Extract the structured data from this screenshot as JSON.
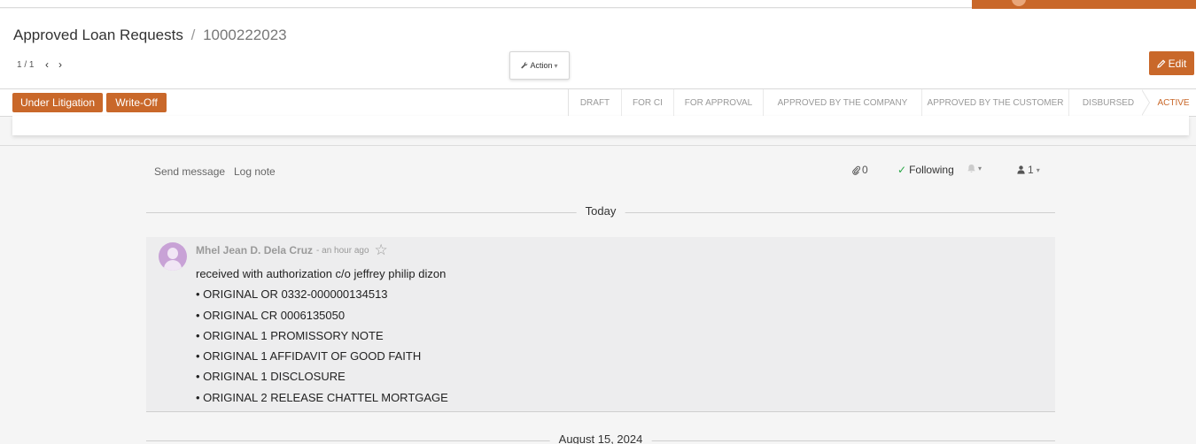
{
  "breadcrumb": {
    "parent": "Approved Loan Requests",
    "separator": "/",
    "record": "1000222023"
  },
  "pager": {
    "value": "1 / 1"
  },
  "buttons": {
    "action": "Action",
    "edit": "Edit",
    "under_litigation": "Under Litigation",
    "write_off": "Write-Off"
  },
  "stages": [
    "DRAFT",
    "FOR CI",
    "FOR APPROVAL",
    "APPROVED BY THE COMPANY",
    "APPROVED BY THE CUSTOMER",
    "DISBURSED",
    "ACTIVE"
  ],
  "active_stage": "ACTIVE",
  "chatter": {
    "send_message": "Send message",
    "log_note": "Log note",
    "attachments": "0",
    "following": "Following",
    "followers": "1"
  },
  "date_separators": {
    "today": "Today",
    "previous": "August 15, 2024"
  },
  "message": {
    "author": "Mhel Jean D. Dela Cruz",
    "time": "- an hour ago",
    "lines": [
      "received  with authorization c/o jeffrey philip dizon",
      "• ORIGINAL OR 0332-000000134513",
      "• ORIGINAL CR 0006135050",
      "• ORIGINAL 1 PROMISSORY NOTE",
      "• ORIGINAL 1 AFFIDAVIT OF GOOD FAITH",
      "• ORIGINAL 1 DISCLOSURE",
      "• ORIGINAL 2 RELEASE CHATTEL MORTGAGE"
    ]
  },
  "colors": {
    "accent": "#c9682a",
    "check": "#28a745"
  },
  "icons": {
    "action": "wrench-icon",
    "edit": "pencil-icon",
    "attachment": "paperclip-icon",
    "followers": "user-icon",
    "bell": "bell-icon",
    "star": "star-icon"
  }
}
